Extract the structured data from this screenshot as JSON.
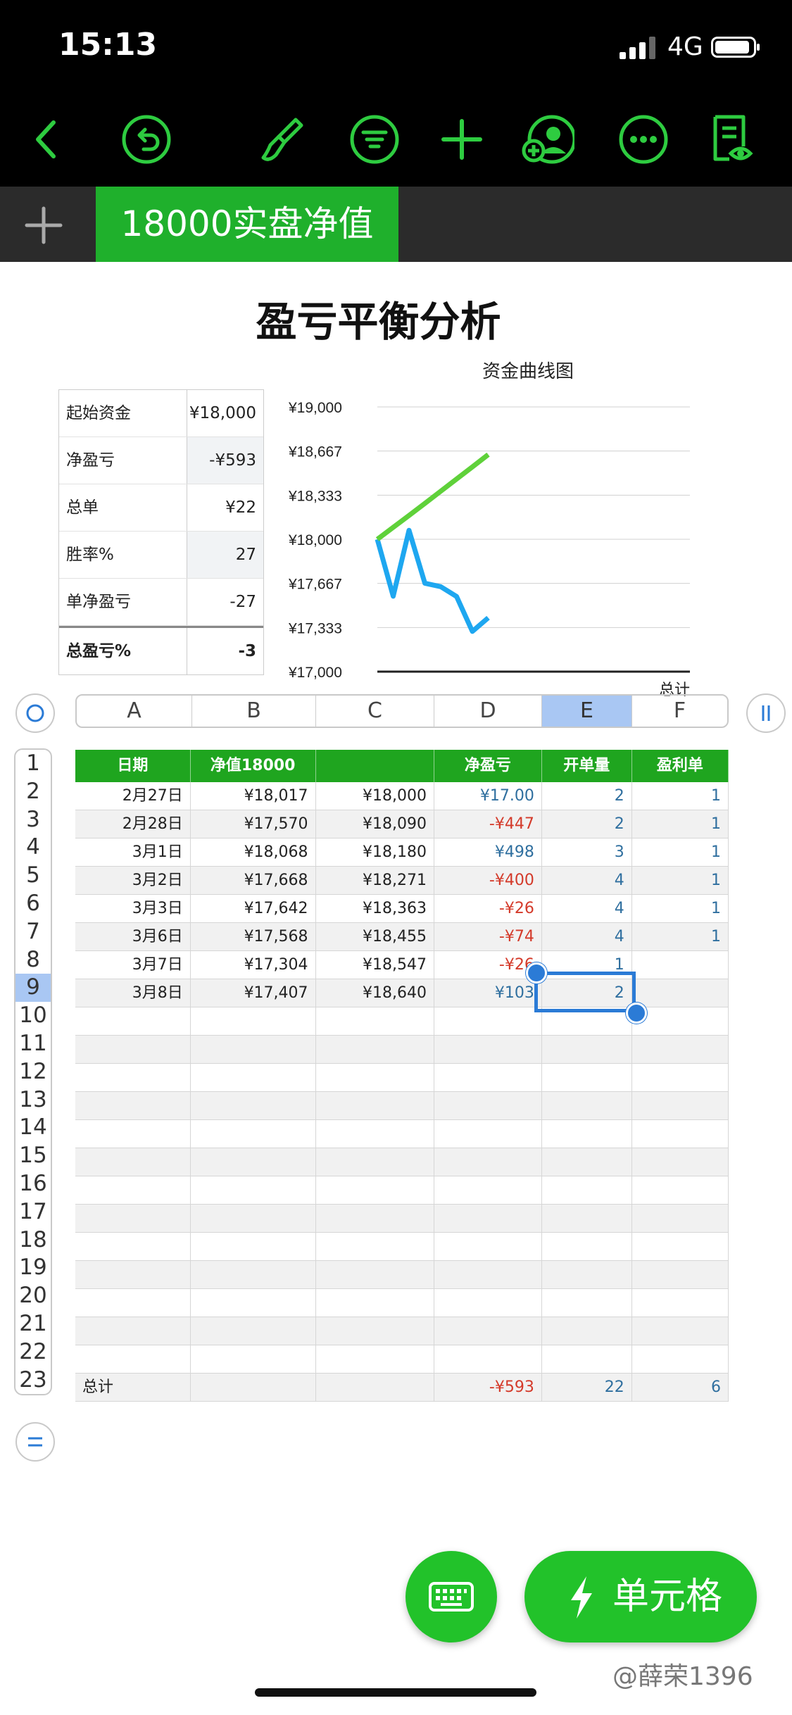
{
  "status_bar": {
    "time": "15:13",
    "network": "4G"
  },
  "toolbar": {
    "icons": [
      "back-icon",
      "undo-icon",
      "format-brush-icon",
      "filter-icon",
      "add-icon",
      "collaborate-icon",
      "more-icon",
      "view-options-icon"
    ],
    "accent_color": "#2ecc40"
  },
  "sheet_tabs": {
    "add_icon": "plus-icon",
    "active_tab": "18000实盘净值"
  },
  "title": "盈亏平衡分析",
  "summary": [
    {
      "label": "起始资金",
      "value": "¥18,000"
    },
    {
      "label": "净盈亏",
      "value": "-¥593"
    },
    {
      "label": "总单",
      "value": "¥22"
    },
    {
      "label": "胜率%",
      "value": "27"
    },
    {
      "label": "单净盈亏",
      "value": "-27"
    },
    {
      "label": "总盈亏%",
      "value": "-3"
    }
  ],
  "chart_data": {
    "type": "line",
    "title": "资金曲线图",
    "x_tick_last": "总计",
    "ylim": [
      17000,
      19000
    ],
    "y_ticks": [
      "¥19,000",
      "¥18,667",
      "¥18,333",
      "¥18,000",
      "¥17,667",
      "¥17,333",
      "¥17,000"
    ],
    "series": [
      {
        "color": "#1ea7f0",
        "values": [
          18000,
          17570,
          18068,
          17668,
          17642,
          17568,
          17304,
          17407
        ]
      },
      {
        "color": "#5fd13a",
        "values": [
          18000,
          18090,
          18180,
          18271,
          18363,
          18455,
          18547,
          18640
        ]
      }
    ]
  },
  "columns": [
    "A",
    "B",
    "C",
    "D",
    "E",
    "F"
  ],
  "selected_column": "E",
  "row_numbers": [
    "1",
    "2",
    "3",
    "4",
    "5",
    "6",
    "7",
    "8",
    "9",
    "10",
    "11",
    "12",
    "13",
    "14",
    "15",
    "16",
    "17",
    "18",
    "19",
    "20",
    "21",
    "22",
    "23"
  ],
  "selected_row": "9",
  "table": {
    "headers": [
      "日期",
      "净值18000",
      "",
      "净盈亏",
      "开单量",
      "盈利单"
    ],
    "rows": [
      [
        "2月27日",
        "¥18,017",
        "¥18,000",
        "¥17.00",
        "2",
        "1"
      ],
      [
        "2月28日",
        "¥17,570",
        "¥18,090",
        "-¥447",
        "2",
        "1"
      ],
      [
        "3月1日",
        "¥18,068",
        "¥18,180",
        "¥498",
        "3",
        "1"
      ],
      [
        "3月2日",
        "¥17,668",
        "¥18,271",
        "-¥400",
        "4",
        "1"
      ],
      [
        "3月3日",
        "¥17,642",
        "¥18,363",
        "-¥26",
        "4",
        "1"
      ],
      [
        "3月6日",
        "¥17,568",
        "¥18,455",
        "-¥74",
        "4",
        "1"
      ],
      [
        "3月7日",
        "¥17,304",
        "¥18,547",
        "-¥26",
        "1",
        ""
      ],
      [
        "3月8日",
        "¥17,407",
        "¥18,640",
        "¥103",
        "2",
        ""
      ]
    ],
    "total_row": [
      "总计",
      "",
      "",
      "-¥593",
      "22",
      "6"
    ]
  },
  "bottom": {
    "cell_button": "单元格",
    "keyboard_icon": "keyboard-icon"
  },
  "watermark": "@薛荣1396"
}
